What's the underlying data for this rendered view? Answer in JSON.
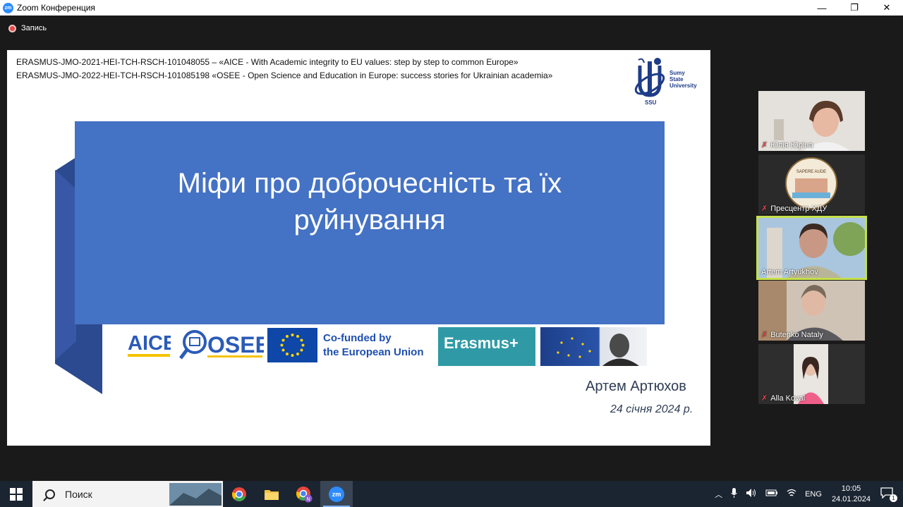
{
  "window": {
    "logo_text": "zm",
    "title": "Zoom Конференция",
    "controls": [
      "—",
      "❐",
      "✕"
    ]
  },
  "recording": {
    "label": "Запись"
  },
  "slide": {
    "project_lines": [
      "ERASMUS-JMO-2021-HEI-TCH-RSCH-101048055 – «AICE - With Academic integrity to EU values: step by step to common Europe»",
      "ERASMUS-JMO-2022-HEI-TCH-RSCH-101085198  «OSEE - Open Science and Education in Europe: success stories for Ukrainian academia»"
    ],
    "university": {
      "line1": "Sumy",
      "line2": "State",
      "line3": "University",
      "abbr": "SSU"
    },
    "title_line1": "Міфи про доброчесність та їх",
    "title_line2": "руйнування",
    "logos": {
      "aice": "AICE",
      "osee": "OSEE",
      "eu_text_line1": "Co-funded by",
      "eu_text_line2": "the European Union",
      "erasmus": "Erasmus+"
    },
    "author": "Артем Артюхов",
    "date": "24 січня 2024 р."
  },
  "participants": [
    {
      "name": "Юлія Юріна",
      "muted": true
    },
    {
      "name": "Пресцентр ХДУ",
      "muted": true,
      "badge_text": "SAPERE AUDE"
    },
    {
      "name": "Artem Artyukhov",
      "muted": false,
      "active": true
    },
    {
      "name": "Butenko Nataly",
      "muted": true
    },
    {
      "name": "Alla Koval",
      "muted": true
    }
  ],
  "taskbar": {
    "search_placeholder": "Поиск",
    "search_badge": "N",
    "zoom_app": "zm",
    "tray": {
      "language": "ENG",
      "time": "10:05",
      "date": "24.01.2024",
      "notifications": "1"
    }
  },
  "colors": {
    "slide_title_bg": "#4472c4",
    "active_speaker_border": "#c5e04b",
    "taskbar_bg": "#1b2431",
    "zoom_blue": "#2d8cff"
  }
}
